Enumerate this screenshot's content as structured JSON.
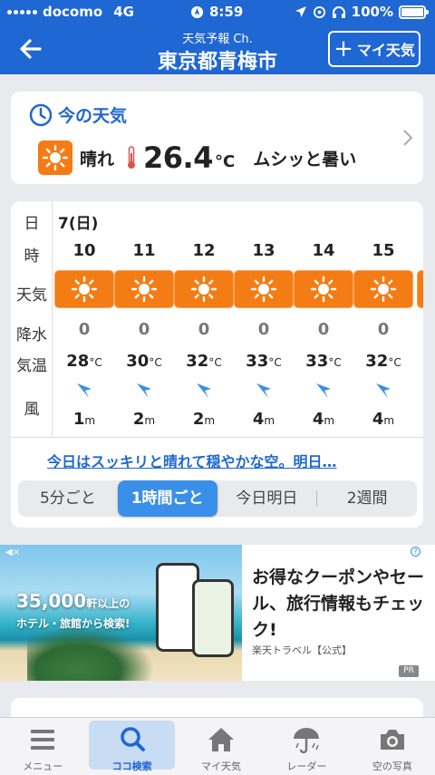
{
  "status_bar": {
    "carrier": "docomo",
    "network": "4G",
    "time": "8:59",
    "battery": "100%"
  },
  "header": {
    "subtitle": "天気予報 Ch.",
    "title": "東京都青梅市",
    "my_weather_button": "マイ天気"
  },
  "current": {
    "heading": "今の天気",
    "condition": "晴れ",
    "temperature": "26.4",
    "temperature_unit": "°C",
    "feeling": "ムシッと暑い"
  },
  "hourly": {
    "row_labels": {
      "day": "日",
      "hour": "時",
      "weather": "天気",
      "precip": "降水",
      "temp": "気温",
      "wind": "風"
    },
    "date": "7(日)",
    "temp_unit": "°C",
    "wind_unit": "m",
    "hours": [
      {
        "hour": "10",
        "weather_icon": "sun-icon",
        "precip": "0",
        "temp": "28",
        "wind_speed": "1"
      },
      {
        "hour": "11",
        "weather_icon": "sun-icon",
        "precip": "0",
        "temp": "30",
        "wind_speed": "2"
      },
      {
        "hour": "12",
        "weather_icon": "sun-icon",
        "precip": "0",
        "temp": "32",
        "wind_speed": "2"
      },
      {
        "hour": "13",
        "weather_icon": "sun-icon",
        "precip": "0",
        "temp": "33",
        "wind_speed": "4"
      },
      {
        "hour": "14",
        "weather_icon": "sun-icon",
        "precip": "0",
        "temp": "33",
        "wind_speed": "4"
      },
      {
        "hour": "15",
        "weather_icon": "sun-icon",
        "precip": "0",
        "temp": "32",
        "wind_speed": "4"
      }
    ],
    "summary": "今日はスッキリと晴れて穏やかな空。明日…",
    "segments": [
      "5分ごと",
      "1時間ごと",
      "今日明日",
      "2週間"
    ],
    "active_segment": "1時間ごと"
  },
  "ad": {
    "image_count": "35,000",
    "image_count_suffix": "軒以上の",
    "image_sub": "ホテル・旅館から検索!",
    "text": "お得なクーポンやセール、旅行情報もチェック!",
    "brand": "楽天トラベル【公式】",
    "pr_label": "PR"
  },
  "bottom_nav": [
    {
      "label": "メニュー",
      "icon": "menu-icon"
    },
    {
      "label": "ココ検索",
      "icon": "search-icon"
    },
    {
      "label": "マイ天気",
      "icon": "home-icon"
    },
    {
      "label": "レーダー",
      "icon": "radar-umbrella-icon"
    },
    {
      "label": "空の写真",
      "icon": "camera-icon"
    }
  ],
  "colors": {
    "brand_blue": "#1f67d2",
    "sun_orange": "#f47c14",
    "active_segment": "#3a8fe8"
  }
}
